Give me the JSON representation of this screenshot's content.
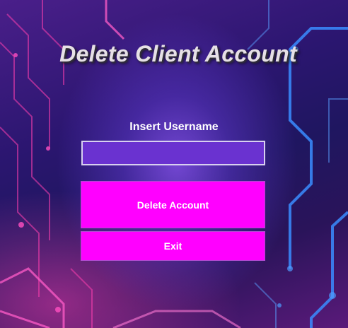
{
  "form": {
    "title": "Delete Client Account",
    "username_label": "Insert Username",
    "username_value": "",
    "delete_button_label": "Delete Account",
    "exit_button_label": "Exit"
  },
  "colors": {
    "button_background": "#ff00ff",
    "input_background": "#6a32d0",
    "title_text": "#e6e0e6",
    "label_text": "#ffffff"
  }
}
